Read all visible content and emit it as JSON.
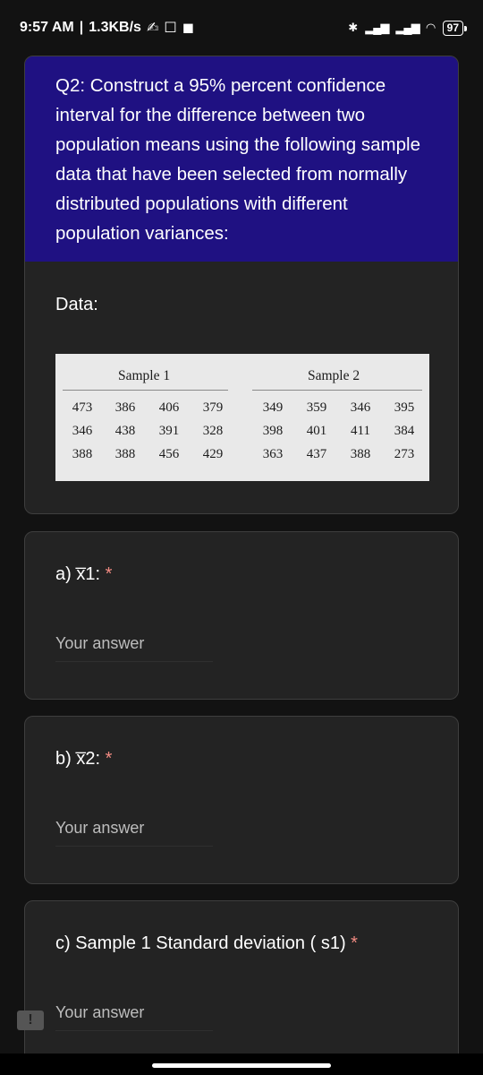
{
  "status_bar": {
    "time": "9:57 AM",
    "speed": "1.3KB/s",
    "battery": "97",
    "icons": [
      "pen-icon",
      "square-icon",
      "video-icon",
      "bluetooth-icon",
      "signal-icon",
      "wifi-icon",
      "battery-icon"
    ]
  },
  "question": {
    "title": "Q2: Construct a 95% percent confidence interval for the difference between two population means using the following sample data that have been selected from normally distributed populations with different population variances:",
    "data_label": "Data:",
    "sample1_header": "Sample 1",
    "sample2_header": "Sample 2",
    "rows": [
      [
        "473",
        "386",
        "406",
        "379",
        "349",
        "359",
        "346",
        "395"
      ],
      [
        "346",
        "438",
        "391",
        "328",
        "398",
        "401",
        "411",
        "384"
      ],
      [
        "388",
        "388",
        "456",
        "429",
        "363",
        "437",
        "388",
        "273"
      ]
    ]
  },
  "answers": [
    {
      "label": "a) x̅1:",
      "required": "*",
      "placeholder": "Your answer"
    },
    {
      "label": "b) x̅2:",
      "required": "*",
      "placeholder": "Your answer"
    },
    {
      "label": "c) Sample 1 Standard deviation ( s1)",
      "required": "*",
      "placeholder": "Your answer"
    }
  ],
  "feedback_icon": "!"
}
